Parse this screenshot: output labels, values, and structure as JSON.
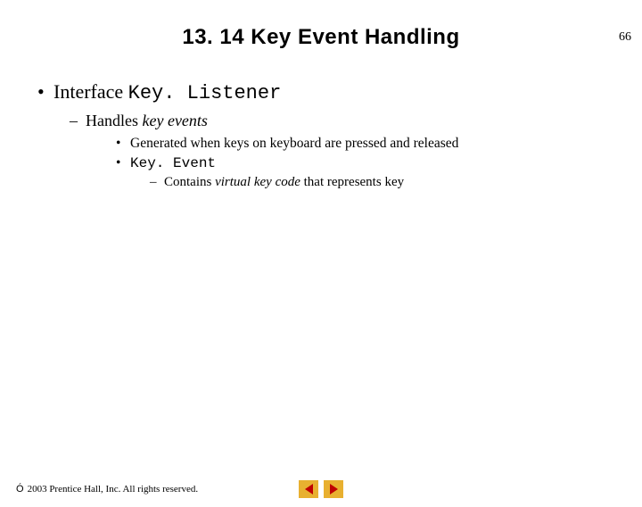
{
  "page_number": "66",
  "title": "13. 14  Key Event Handling",
  "bullet1": {
    "prefix": "Interface ",
    "code": "Key. Listener"
  },
  "dash2": {
    "prefix": "Handles ",
    "italic": "key events"
  },
  "bullet3a": "Generated when keys on keyboard are pressed and released",
  "bullet3b_code": "Key. Event",
  "dash4": {
    "prefix": "Contains ",
    "italic": "virtual key code",
    "suffix": " that represents key"
  },
  "copyright": " 2003 Prentice Hall, Inc. All rights reserved."
}
